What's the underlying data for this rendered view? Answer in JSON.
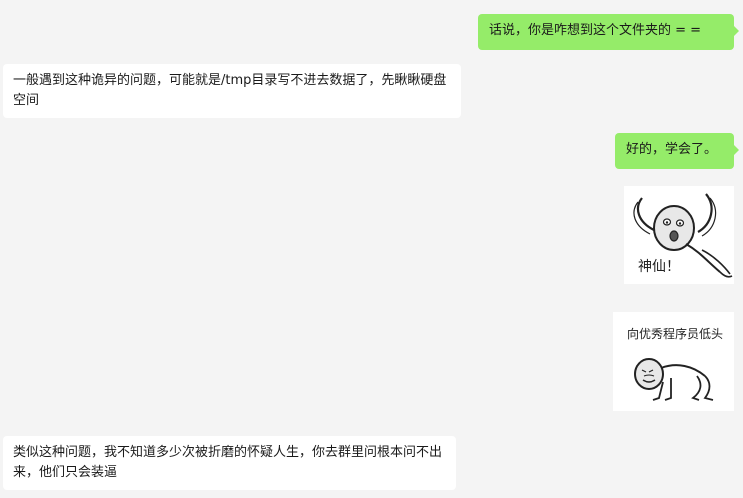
{
  "messages": [
    {
      "side": "right",
      "text": "话说，你是咋想到这个文件夹的 = ="
    },
    {
      "side": "left",
      "text": "一般遇到这种诡异的问题，可能就是/tmp目录写不进去数据了，先瞅瞅硬盘空间"
    },
    {
      "side": "right",
      "text": "好的，学会了。"
    },
    {
      "side": "right",
      "sticker": "shocked-meme-sticker",
      "caption": "神仙！"
    },
    {
      "side": "right",
      "sticker": "kneeling-meme-sticker",
      "caption": "向优秀程序员低头"
    },
    {
      "side": "left",
      "text": "类似这种问题，我不知道多少次被折磨的怀疑人生，你去群里问根本问不出来，他们只会装逼"
    }
  ]
}
